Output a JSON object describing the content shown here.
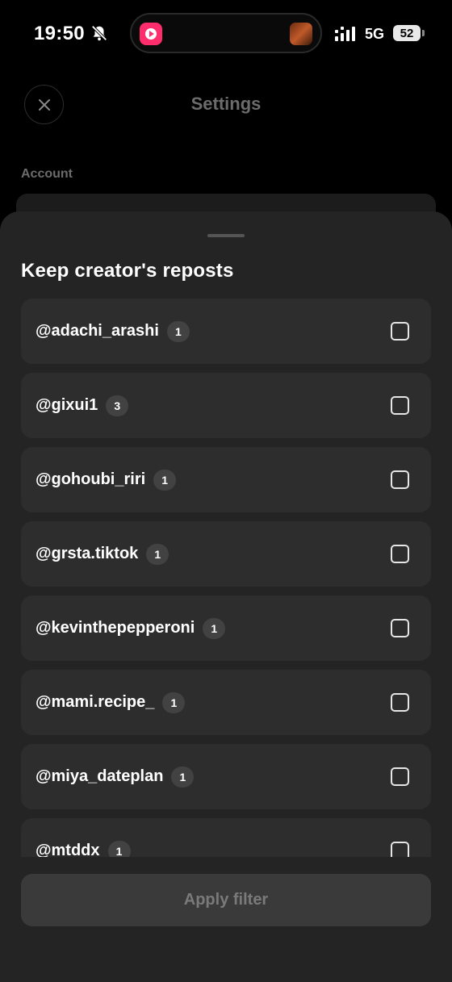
{
  "status_bar": {
    "time": "19:50",
    "network": "5G",
    "battery": "52",
    "icons": [
      "bell-slash-icon",
      "signal-icon",
      "battery-icon"
    ]
  },
  "header": {
    "title": "Settings",
    "close_icon": "close-icon"
  },
  "background": {
    "section_label": "Account"
  },
  "sheet": {
    "title": "Keep creator's reposts",
    "items": [
      {
        "handle": "@adachi_arashi",
        "count": "1",
        "checked": false
      },
      {
        "handle": "@gixui1",
        "count": "3",
        "checked": false
      },
      {
        "handle": "@gohoubi_riri",
        "count": "1",
        "checked": false
      },
      {
        "handle": "@grsta.tiktok",
        "count": "1",
        "checked": false
      },
      {
        "handle": "@kevinthepepperoni",
        "count": "1",
        "checked": false
      },
      {
        "handle": "@mami.recipe_",
        "count": "1",
        "checked": false
      },
      {
        "handle": "@miya_dateplan",
        "count": "1",
        "checked": false
      },
      {
        "handle": "@mtddx",
        "count": "1",
        "checked": false
      }
    ],
    "apply_label": "Apply filter"
  },
  "colors": {
    "sheet_bg": "#242424",
    "row_bg": "#2d2d2d",
    "button_disabled_bg": "#3a3a3a",
    "button_disabled_text": "#7a7a7a",
    "muted_text": "#6c6c6c",
    "app_accent": "#ff2d6b"
  }
}
